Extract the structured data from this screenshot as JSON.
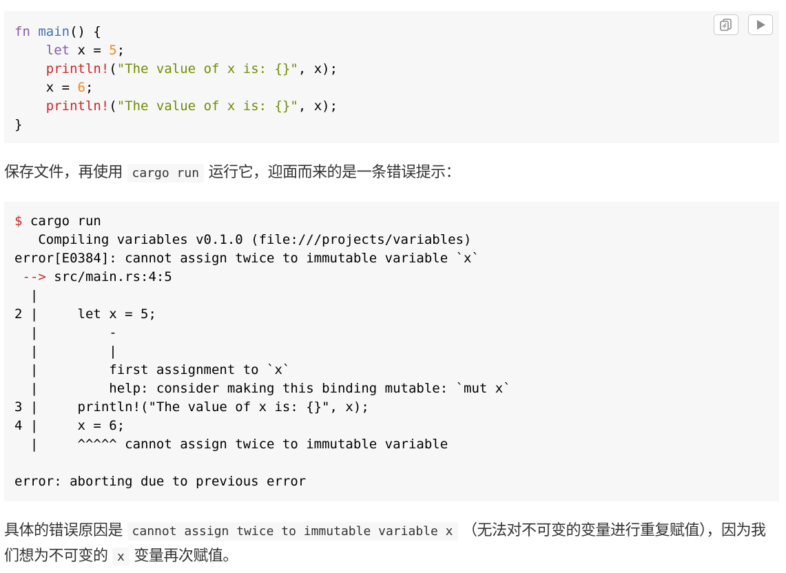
{
  "buttons": {
    "copy_icon": "copy-icon",
    "play_icon": "play-icon"
  },
  "code1": {
    "line1": {
      "kw": "fn",
      "name": "main",
      "rest": "() {"
    },
    "line2": {
      "indent": "    ",
      "kw": "let",
      "mid": " x = ",
      "num": "5",
      "end": ";"
    },
    "line3": {
      "indent": "    ",
      "macro": "println!",
      "open": "(",
      "str": "\"The value of x is: {}\"",
      "end": ", x);"
    },
    "line4": {
      "indent": "    x = ",
      "num": "6",
      "end": ";"
    },
    "line5": {
      "indent": "    ",
      "macro": "println!",
      "open": "(",
      "str": "\"The value of x is: {}\"",
      "end": ", x);"
    },
    "line6": "}"
  },
  "para1": {
    "before": "保存文件，再使用",
    "code": "cargo run",
    "after": "运行它，迎面而来的是一条错误提示："
  },
  "code2": {
    "prompt": "$",
    "command": " cargo run",
    "lines": [
      "   Compiling variables v0.1.0 (file:///projects/variables)",
      "error[E0384]: cannot assign twice to immutable variable `x`"
    ],
    "arrow": " -->",
    "location": " src/main.rs:4:5",
    "rest": [
      "  |",
      "2 |     let x = 5;",
      "  |         -",
      "  |         |",
      "  |         first assignment to `x`",
      "  |         help: consider making this binding mutable: `mut x`",
      "3 |     println!(\"The value of x is: {}\", x);",
      "4 |     x = 6;",
      "  |     ^^^^^ cannot assign twice to immutable variable",
      "",
      "error: aborting due to previous error"
    ]
  },
  "para2": {
    "before": "具体的错误原因是",
    "code1": "cannot assign twice to immutable variable x",
    "middle": "（无法对不可变的变量进行重复赋值），因为我们想为不可变的",
    "code2": "x",
    "after": "变量再次赋值。"
  }
}
